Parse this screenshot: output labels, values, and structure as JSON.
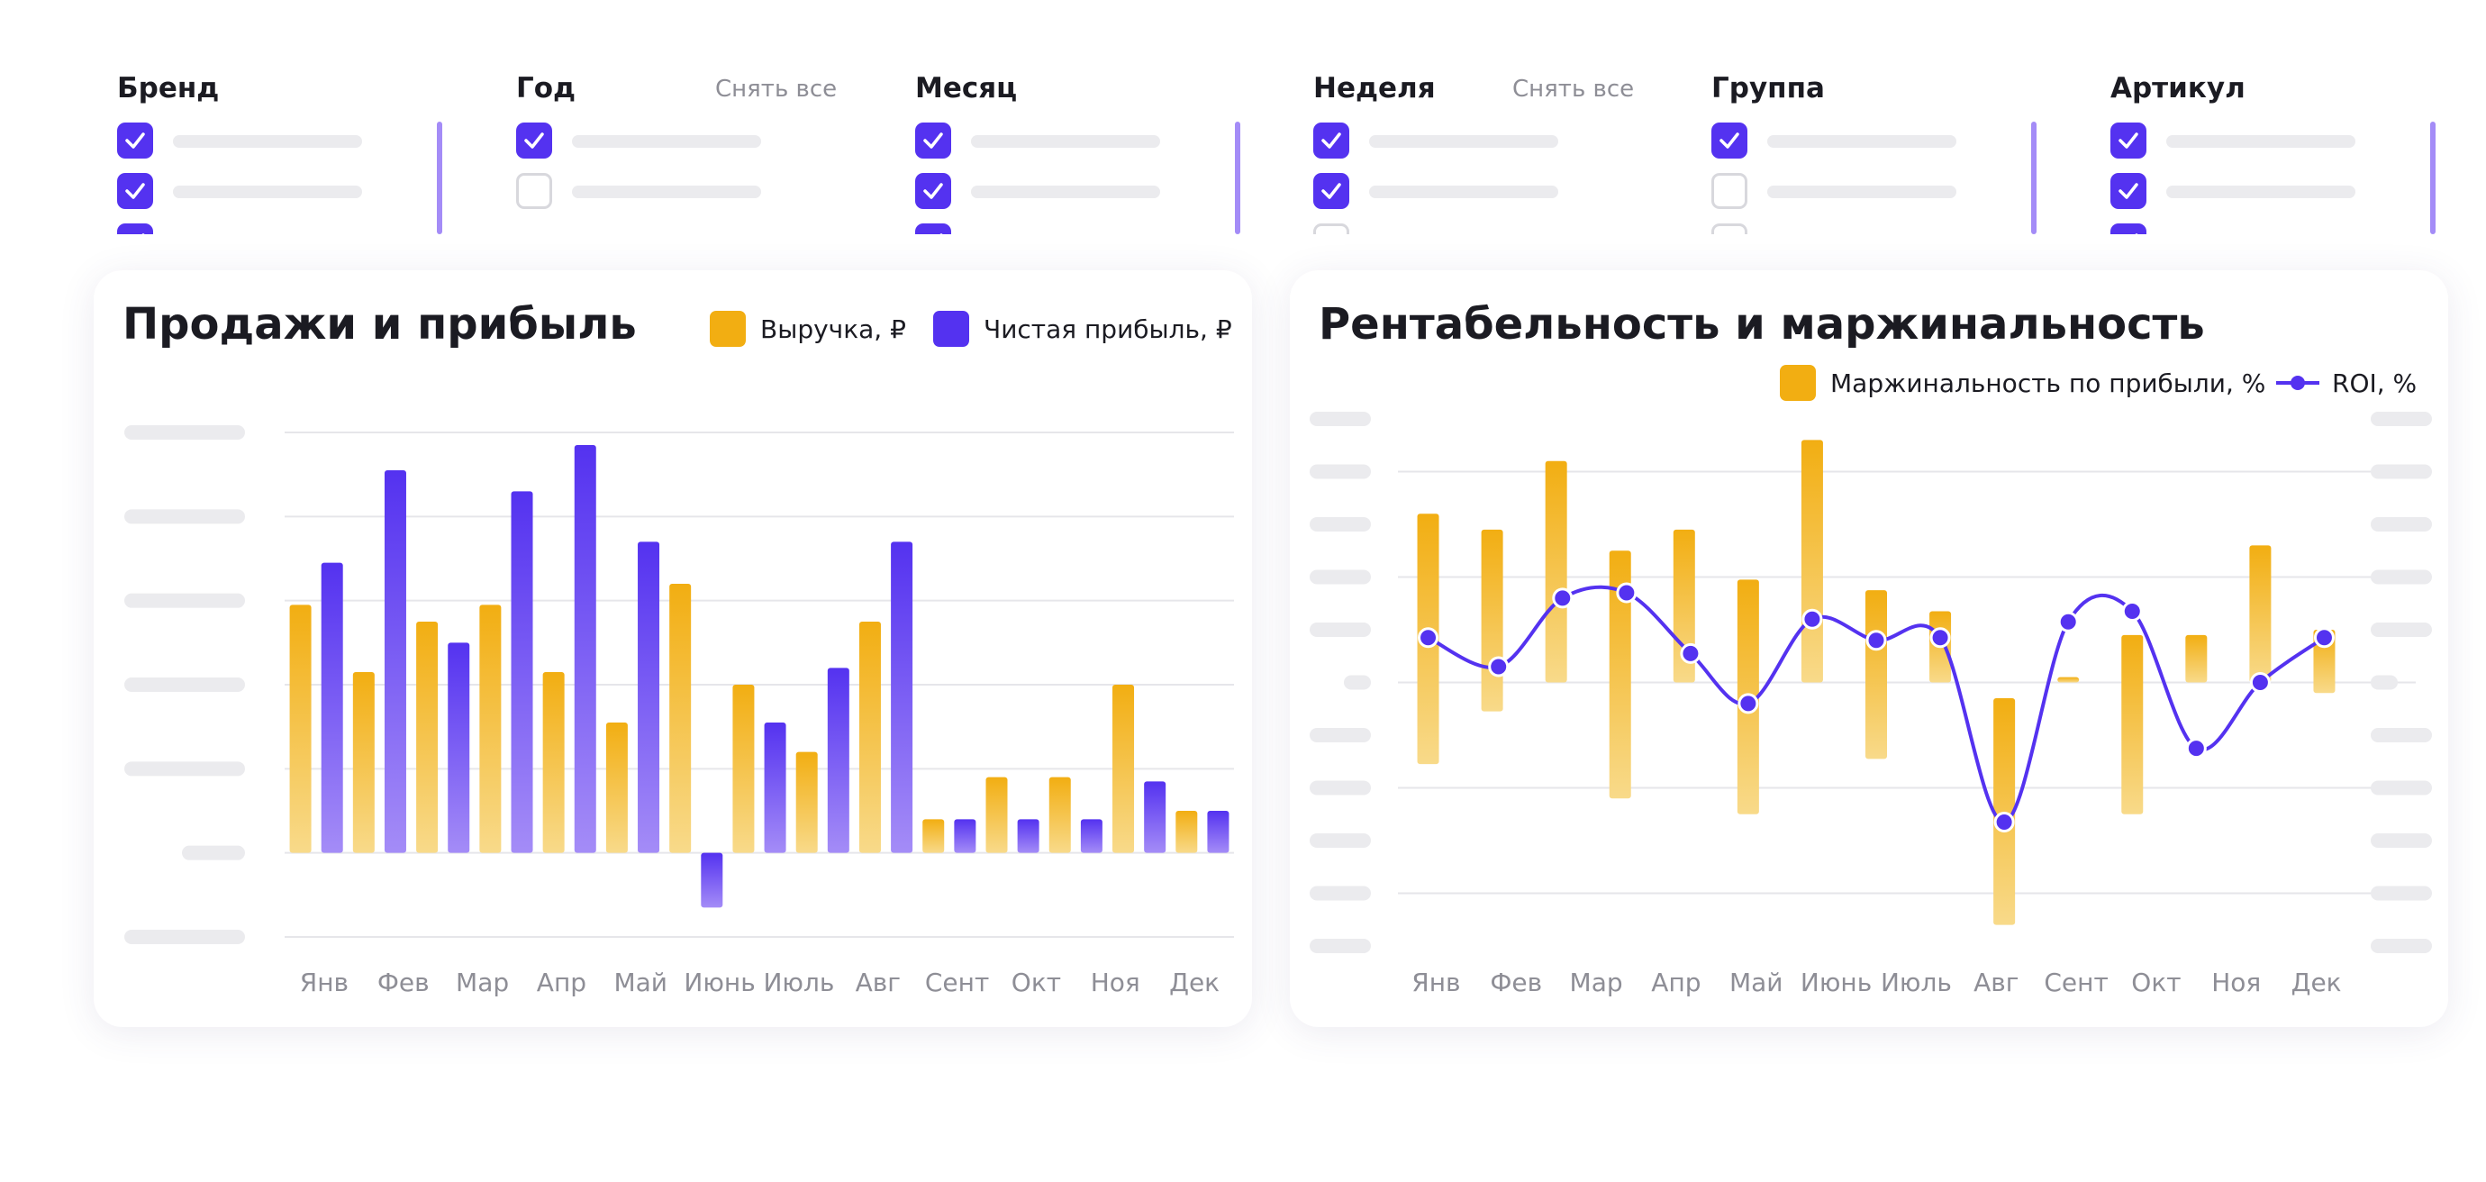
{
  "filters": [
    {
      "title": "Бренд",
      "clear": "",
      "checks": [
        true,
        true,
        true
      ],
      "scrollbar": true
    },
    {
      "title": "Год",
      "clear": "Снять все",
      "checks": [
        true,
        false
      ],
      "scrollbar": false
    },
    {
      "title": "Месяц",
      "clear": "",
      "checks": [
        true,
        true,
        true
      ],
      "scrollbar": true
    },
    {
      "title": "Неделя",
      "clear": "Снять все",
      "checks": [
        true,
        true,
        false
      ],
      "scrollbar": false
    },
    {
      "title": "Группа",
      "clear": "",
      "checks": [
        true,
        false,
        false
      ],
      "scrollbar": true
    },
    {
      "title": "Артикул",
      "clear": "",
      "checks": [
        true,
        true,
        true
      ],
      "scrollbar": true
    }
  ],
  "colors": {
    "revenue": "#f2ae12",
    "profit": "#5432f0",
    "roi": "#5432f0",
    "grid": "#e6e6ea",
    "tick": "#8e8e96"
  },
  "chart_data": [
    {
      "type": "bar",
      "title": "Продажи и прибыль",
      "categories": [
        "Янв",
        "Фев",
        "Мар",
        "Апр",
        "Май",
        "Июнь",
        "Июль",
        "Авг",
        "Сент",
        "Окт",
        "Ноя",
        "Дек"
      ],
      "series": [
        {
          "name": "Выручка, ₽",
          "values": [
            2.95,
            2.15,
            2.75,
            2.95,
            2.15,
            3.2,
            2.0,
            1.2,
            2.75,
            0.4,
            0.9,
            0.5
          ]
        },
        {
          "name": "Чистая прибыль, ₽",
          "values": [
            3.45,
            4.55,
            2.5,
            4.3,
            4.85,
            3.7,
            1.55,
            2.2,
            3.7,
            0.4,
            0.4,
            0.85
          ]
        }
      ],
      "bars_in_order": [
        {
          "series": 0,
          "value": 2.95
        },
        {
          "series": 1,
          "value": 3.45
        },
        {
          "series": 0,
          "value": 2.15
        },
        {
          "series": 1,
          "value": 4.55
        },
        {
          "series": 0,
          "value": 2.75
        },
        {
          "series": 1,
          "value": 2.5
        },
        {
          "series": 0,
          "value": 2.95
        },
        {
          "series": 1,
          "value": 4.3
        },
        {
          "series": 0,
          "value": 2.15
        },
        {
          "series": 1,
          "value": 4.85
        },
        {
          "series": 0,
          "value": 1.55
        },
        {
          "series": 1,
          "value": 3.7
        },
        {
          "series": 0,
          "value": 3.2
        },
        {
          "series": 1,
          "value": -0.65
        },
        {
          "series": 0,
          "value": 2.0
        },
        {
          "series": 1,
          "value": 1.55
        },
        {
          "series": 0,
          "value": 1.2
        },
        {
          "series": 1,
          "value": 2.2
        },
        {
          "series": 0,
          "value": 2.75
        },
        {
          "series": 1,
          "value": 3.7
        },
        {
          "series": 0,
          "value": 0.4
        },
        {
          "series": 1,
          "value": 0.4
        },
        {
          "series": 0,
          "value": 0.9
        },
        {
          "series": 1,
          "value": 0.4
        },
        {
          "series": 0,
          "value": 0.9
        },
        {
          "series": 1,
          "value": 0.4
        },
        {
          "series": 0,
          "value": 2.0
        },
        {
          "series": 1,
          "value": 0.85
        },
        {
          "series": 0,
          "value": 0.5
        },
        {
          "series": 1,
          "value": 0.5
        }
      ],
      "ylim": [
        -1,
        5
      ],
      "yticks": [
        -1,
        0,
        1,
        2,
        3,
        4,
        5
      ],
      "ytick_labels_visible": false,
      "grid": true,
      "legend": "top-right"
    },
    {
      "type": "bar",
      "title": "Рентабельность и маржинальность",
      "categories": [
        "Янв",
        "Фев",
        "Мар",
        "Апр",
        "Май",
        "Июнь",
        "Июль",
        "Авг",
        "Сент",
        "Окт",
        "Ноя",
        "Дек"
      ],
      "series": [
        {
          "name": "Маржинальность по прибыли, %",
          "kind": "floating-bar"
        },
        {
          "name": "ROI, %",
          "kind": "line"
        }
      ],
      "bars_in_order": [
        {
          "low": -1.55,
          "high": 3.2
        },
        {
          "low": -0.55,
          "high": 2.9
        },
        {
          "low": 0.0,
          "high": 4.2
        },
        {
          "low": -2.2,
          "high": 2.5
        },
        {
          "low": 0.0,
          "high": 2.9
        },
        {
          "low": -2.5,
          "high": 1.95
        },
        {
          "low": 0.0,
          "high": 4.6
        },
        {
          "low": -1.45,
          "high": 1.75
        },
        {
          "low": 0.0,
          "high": 1.35
        },
        {
          "low": -4.6,
          "high": -0.3
        },
        {
          "low": 0.0,
          "high": 0.1
        },
        {
          "low": -2.5,
          "high": 0.9
        },
        {
          "low": 0.0,
          "high": 0.9
        },
        {
          "low": 0.0,
          "high": 2.6
        },
        {
          "low": -0.2,
          "high": 1.0
        }
      ],
      "roi_points": [
        {
          "x": 0.0,
          "y": 0.85
        },
        {
          "x": 1.1,
          "y": 0.3
        },
        {
          "x": 2.1,
          "y": 1.6
        },
        {
          "x": 3.1,
          "y": 1.7
        },
        {
          "x": 4.1,
          "y": 0.55
        },
        {
          "x": 5.0,
          "y": -0.4
        },
        {
          "x": 6.0,
          "y": 1.2
        },
        {
          "x": 7.0,
          "y": 0.8
        },
        {
          "x": 8.0,
          "y": 0.85
        },
        {
          "x": 9.0,
          "y": -2.65
        },
        {
          "x": 10.0,
          "y": 1.15
        },
        {
          "x": 11.0,
          "y": 1.35
        },
        {
          "x": 12.0,
          "y": -1.25
        },
        {
          "x": 13.0,
          "y": 0.0
        },
        {
          "x": 14.0,
          "y": 0.85
        }
      ],
      "ylim": [
        -5,
        5
      ],
      "ytick_labels_visible": false,
      "grid": true,
      "legend": "top-right"
    }
  ]
}
